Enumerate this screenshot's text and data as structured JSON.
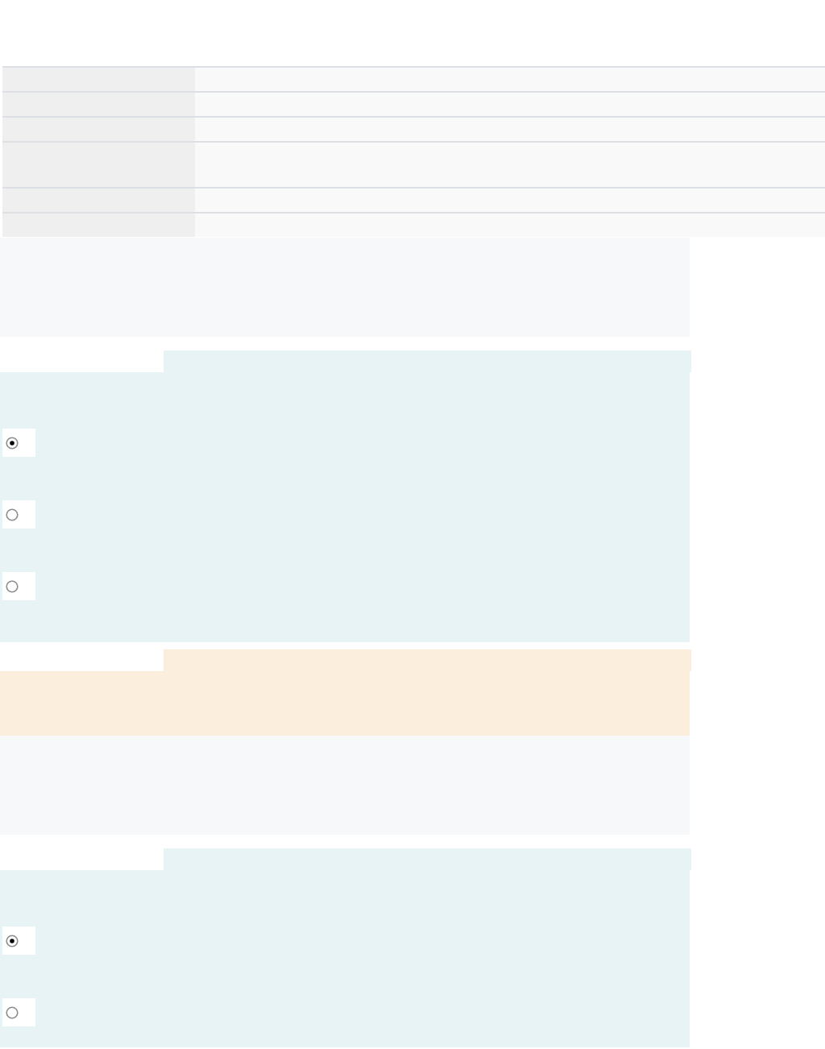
{
  "summary_table": {
    "rows": [
      {
        "kind": "single"
      },
      {
        "kind": "single"
      },
      {
        "kind": "single"
      },
      {
        "kind": "double"
      },
      {
        "kind": "single"
      },
      {
        "kind": "single"
      }
    ]
  },
  "sections": [
    {
      "kind": "info"
    },
    {
      "kind": "question",
      "options": [
        {
          "selected": true
        },
        {
          "selected": false
        },
        {
          "selected": false
        }
      ]
    },
    {
      "kind": "feedback"
    },
    {
      "kind": "info"
    },
    {
      "kind": "question",
      "options": [
        {
          "selected": true
        },
        {
          "selected": false
        }
      ]
    }
  ]
}
